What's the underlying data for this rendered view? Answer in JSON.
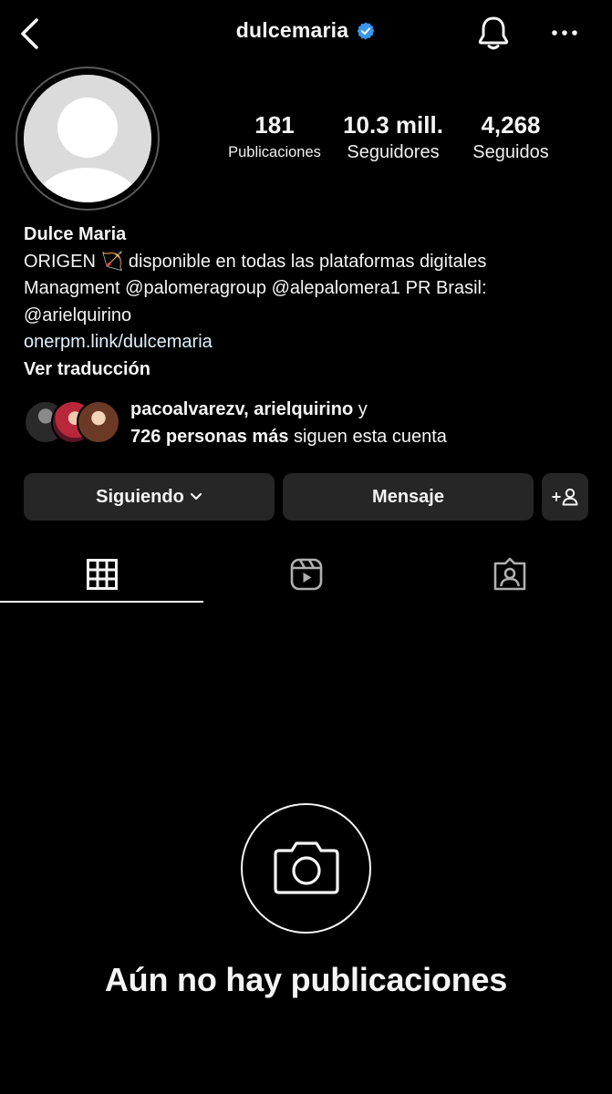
{
  "header": {
    "username": "dulcemaria",
    "verified_color": "#3897f0",
    "icons": [
      "chevron-left-icon",
      "verified-badge-icon",
      "bell-icon",
      "more-horizontal-icon"
    ]
  },
  "profile": {
    "stats": {
      "posts_count": "181",
      "posts_label": "Publicaciones",
      "followers_count": "10.3 mill.",
      "followers_label": "Seguidores",
      "following_count": "4,268",
      "following_label": "Seguidos"
    },
    "bio": {
      "name": "Dulce Maria",
      "line1": "ORIGEN 🏹 disponible en todas las plataformas digitales",
      "line2": "Managment @palomeragroup @alepalomera1 PR Brasil:",
      "line3": "@arielquirino",
      "link": "onerpm.link/dulcemaria",
      "translate": "Ver traducción"
    },
    "followed_by": {
      "names": "pacoalvarezv, arielquirino",
      "conj": " y",
      "others": "726 personas más",
      "suffix": " siguen esta cuenta"
    }
  },
  "actions": {
    "following_label": "Siguiendo",
    "message_label": "Mensaje",
    "suggest_label": "+"
  },
  "tabs": [
    "grid-icon",
    "reels-icon",
    "tagged-icon"
  ],
  "empty_state": {
    "title": "Aún no hay publicaciones",
    "icon": "camera-icon"
  },
  "colors": {
    "background": "#000000",
    "button_bg": "#262626",
    "text": "#f5f5f5"
  }
}
